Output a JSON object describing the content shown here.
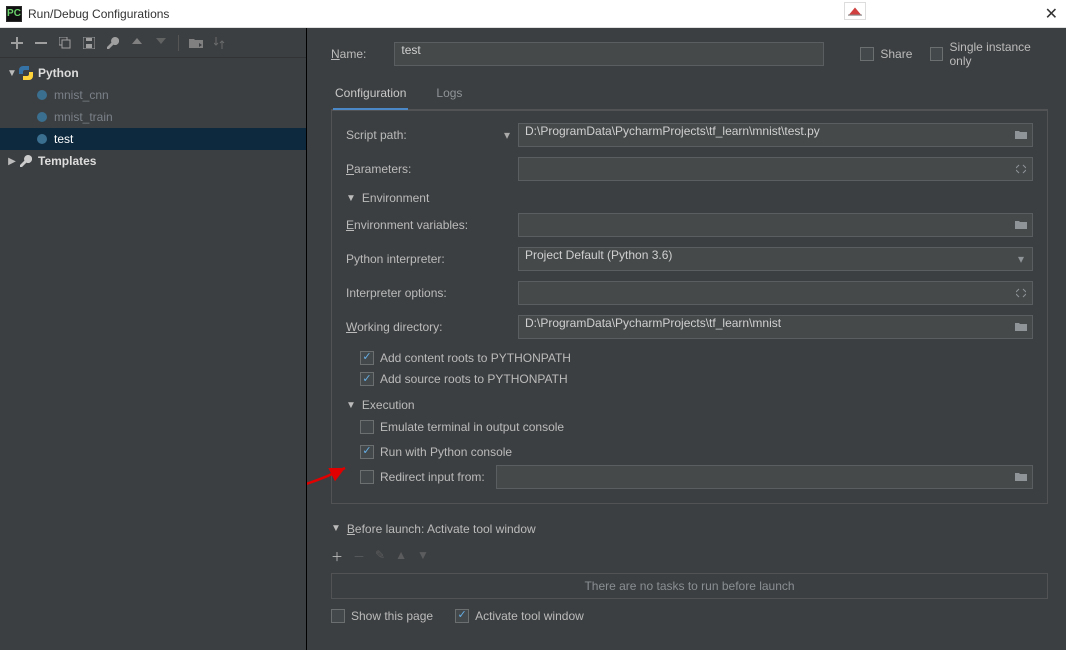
{
  "window": {
    "title": "Run/Debug Configurations"
  },
  "toolbar": {
    "icons": [
      "plus",
      "minus",
      "copy",
      "save",
      "wrench",
      "up",
      "down",
      "folder-move",
      "sort"
    ]
  },
  "tree": {
    "nodes": [
      {
        "label": "Python",
        "icon": "python",
        "expanded": true,
        "bold": true,
        "children": [
          {
            "label": "mnist_cnn",
            "muted": true
          },
          {
            "label": "mnist_train",
            "muted": true
          },
          {
            "label": "test",
            "selected": true
          }
        ]
      },
      {
        "label": "Templates",
        "icon": "wrench",
        "expanded": false,
        "bold": true
      }
    ]
  },
  "name": {
    "label": "Name:",
    "value": "test"
  },
  "share": {
    "label": "Share",
    "checked": false
  },
  "single_instance": {
    "label": "Single instance only",
    "checked": false
  },
  "tabs": {
    "items": [
      "Configuration",
      "Logs"
    ],
    "active": 0
  },
  "config": {
    "fields": {
      "script_path": {
        "label": "Script path:",
        "value": "D:\\ProgramData\\PycharmProjects\\tf_learn\\mnist\\test.py"
      },
      "parameters": {
        "label": "Parameters:",
        "value": ""
      },
      "env_header": "Environment",
      "env_variables": {
        "label": "Environment variables:",
        "value": ""
      },
      "python_interpreter": {
        "label": "Python interpreter:",
        "value": "Project Default (Python 3.6)"
      },
      "interpreter_options": {
        "label": "Interpreter options:",
        "value": ""
      },
      "working_directory": {
        "label": "Working directory:",
        "value": "D:\\ProgramData\\PycharmProjects\\tf_learn\\mnist"
      }
    },
    "checks": {
      "add_content_roots": {
        "label": "Add content roots to PYTHONPATH",
        "checked": true
      },
      "add_source_roots": {
        "label": "Add source roots to PYTHONPATH",
        "checked": true
      }
    },
    "execution_header": "Execution",
    "execution": {
      "emulate_terminal": {
        "label": "Emulate terminal in output console",
        "checked": false
      },
      "run_python_console": {
        "label": "Run with Python console",
        "checked": true
      },
      "redirect_input": {
        "label": "Redirect input from:",
        "checked": false,
        "value": ""
      }
    }
  },
  "before_launch": {
    "header": "Before launch: Activate tool window",
    "empty_text": "There are no tasks to run before launch",
    "show_this_page": {
      "label": "Show this page",
      "checked": false
    },
    "activate_tool_window": {
      "label": "Activate tool window",
      "checked": true
    }
  }
}
